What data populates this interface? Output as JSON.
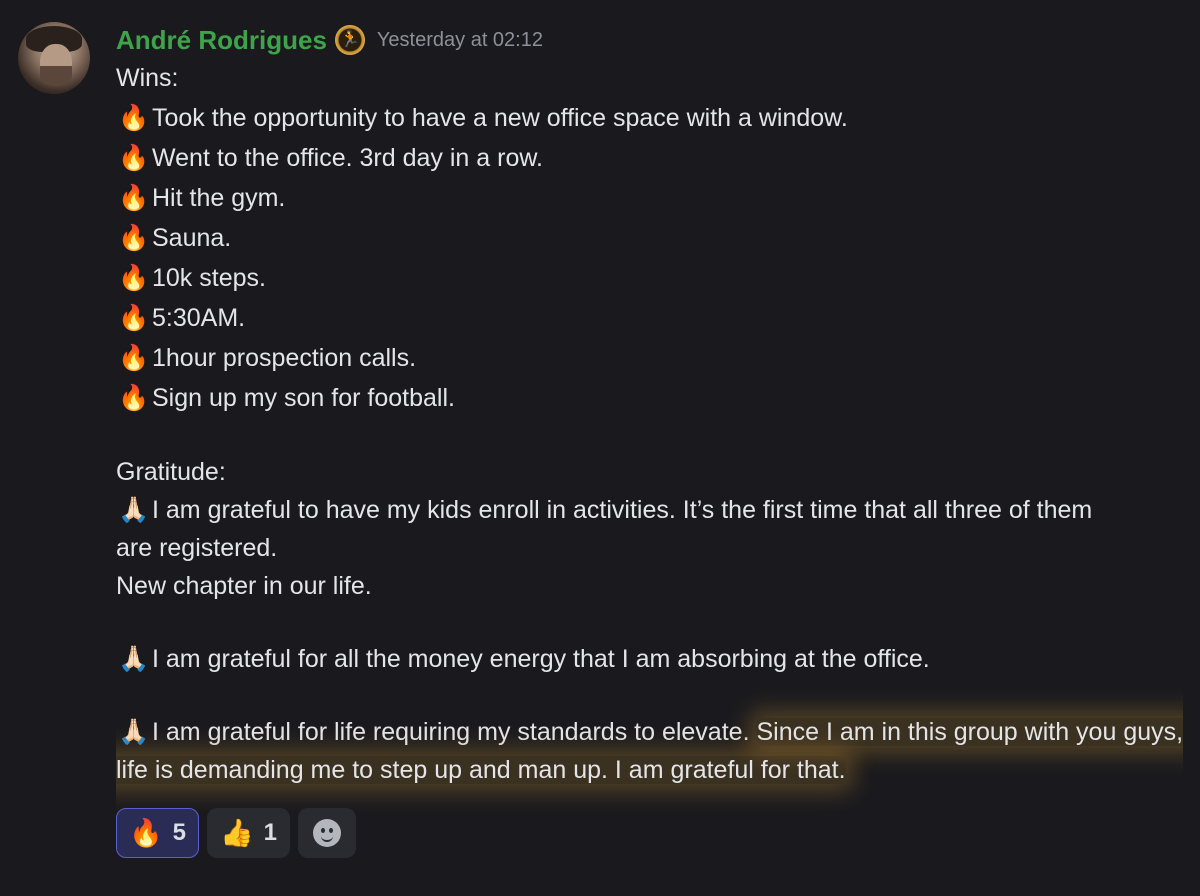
{
  "message": {
    "author": "André Rodrigues",
    "timestamp": "Yesterday at 02:12",
    "role_badge_icon": "runner-badge-icon",
    "colors": {
      "username": "#3fa34a",
      "highlight": "#d49c34",
      "active_reaction_border": "#5960cf"
    },
    "wins_heading": "Wins:",
    "wins": [
      {
        "emoji": "🔥",
        "text": "Took the opportunity to have a new office space with a window."
      },
      {
        "emoji": "🔥",
        "text": "Went to the office. 3rd day in a row."
      },
      {
        "emoji": "🔥",
        "text": "Hit the gym."
      },
      {
        "emoji": "🔥",
        "text": "Sauna."
      },
      {
        "emoji": "🔥",
        "text": "10k steps."
      },
      {
        "emoji": "🔥",
        "text": "5:30AM."
      },
      {
        "emoji": "🔥",
        "text": "1hour prospection calls."
      },
      {
        "emoji": "🔥",
        "text": "Sign up my son for football."
      }
    ],
    "gratitude_heading": "Gratitude:",
    "gratitude": [
      {
        "emoji": "🙏🏻",
        "line1": "I am grateful to have my kids enroll in activities. It’s the first time that all three of them",
        "line2": "are registered.",
        "line3": "New chapter in our life."
      },
      {
        "emoji": "🙏🏻",
        "text": "I am grateful for all the money energy that I am absorbing at the office."
      },
      {
        "emoji": "🙏🏻",
        "text": "I am grateful for life requiring my standards to elevate. ",
        "highlighted_text": "Since I am in this group with you guys, life is demanding me to step up and man up. I am grateful for that."
      }
    ]
  },
  "reactions": [
    {
      "emoji": "🔥",
      "count": "5",
      "active": true
    },
    {
      "emoji": "👍",
      "count": "1",
      "active": false
    }
  ],
  "add_reaction_icon": "add-reaction-smiley-icon"
}
